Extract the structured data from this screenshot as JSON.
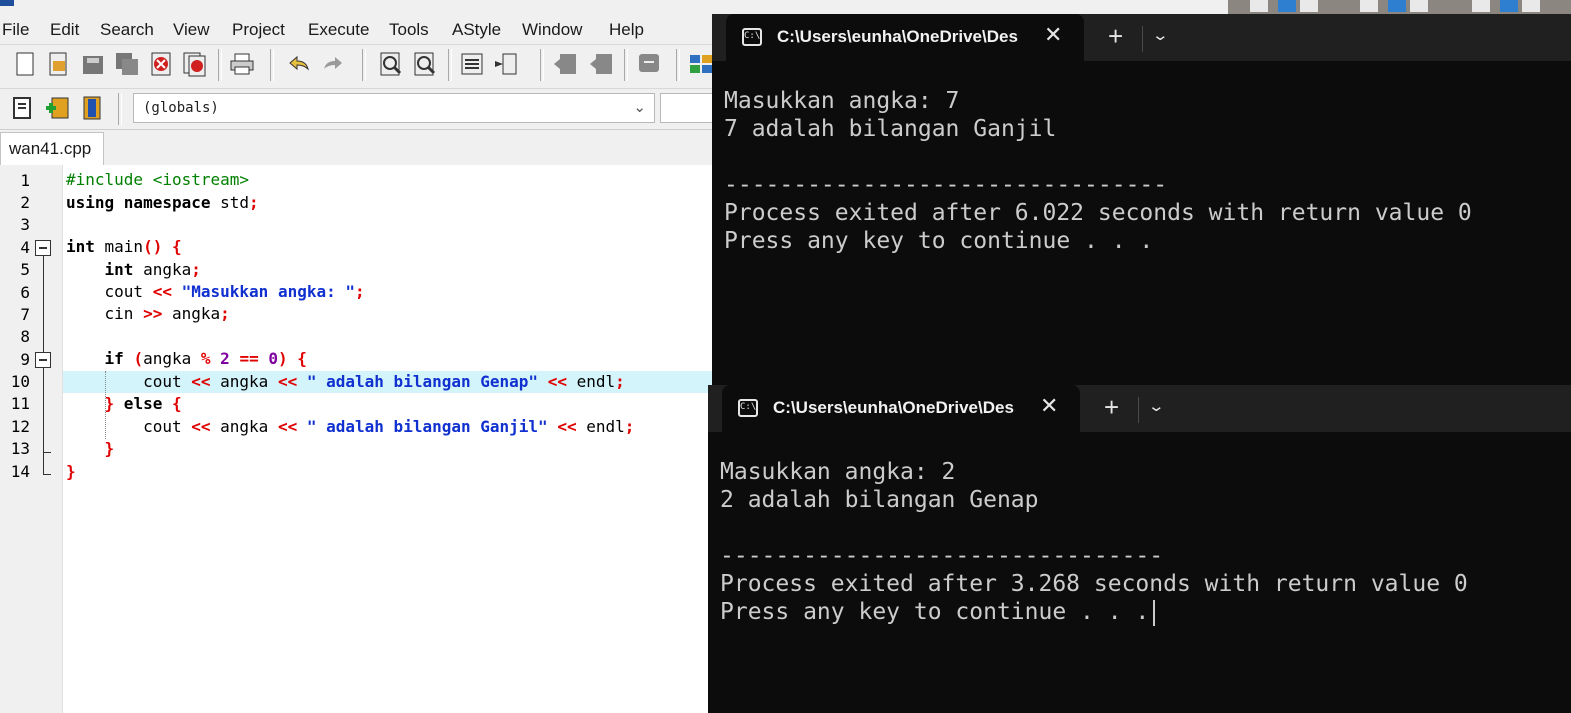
{
  "menu": [
    "File",
    "Edit",
    "Search",
    "View",
    "Project",
    "Execute",
    "Tools",
    "AStyle",
    "Window",
    "Help"
  ],
  "toolbar": {
    "icons": [
      "new-file-icon",
      "open-file-icon",
      "save-icon",
      "save-all-icon",
      "close-icon",
      "close-all-icon",
      "print-icon",
      "undo-icon",
      "redo-icon",
      "find-icon",
      "replace-icon",
      "goto-line-icon",
      "bookmark-icon",
      "indent-icon",
      "unindent-icon",
      "toggle-comment-icon",
      "grid-icon"
    ]
  },
  "toolbar2": {
    "scope_dropdown": "(globals)"
  },
  "editor": {
    "tab": "wan41.cpp",
    "line_numbers": [
      "1",
      "2",
      "3",
      "4",
      "5",
      "6",
      "7",
      "8",
      "9",
      "10",
      "11",
      "12",
      "13",
      "14"
    ]
  },
  "terminal1": {
    "tab_title": "C:\\Users\\eunha\\OneDrive\\Des",
    "line1": "Masukkan angka: 7",
    "line2": "7 adalah bilangan Ganjil",
    "divider": "--------------------------------",
    "line4": "Process exited after 6.022 seconds with return value 0",
    "line5": "Press any key to continue . . ."
  },
  "terminal2": {
    "tab_title": "C:\\Users\\eunha\\OneDrive\\Des",
    "line1": "Masukkan angka: 2",
    "line2": "2 adalah bilangan Genap",
    "divider": "--------------------------------",
    "line4": "Process exited after 3.268 seconds with return value 0",
    "line5": "Press any key to continue . . ."
  }
}
